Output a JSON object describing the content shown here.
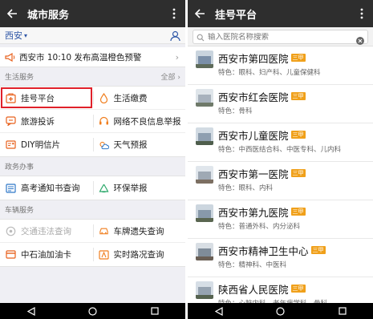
{
  "left": {
    "title": "城市服务",
    "city": "西安",
    "alert": "西安市 10:10 发布高温橙色预警",
    "sections": [
      {
        "name": "生活服务",
        "all_label": "全部",
        "rows": [
          [
            {
              "label": "挂号平台",
              "icon": "hospital-icon"
            },
            {
              "label": "生活缴费",
              "icon": "water-drop-icon"
            }
          ],
          [
            {
              "label": "旅游投诉",
              "icon": "chat-icon"
            },
            {
              "label": "网络不良信息举报",
              "icon": "headset-icon"
            }
          ],
          [
            {
              "label": "DIY明信片",
              "icon": "postcard-icon"
            },
            {
              "label": "天气预报",
              "icon": "weather-icon"
            }
          ]
        ]
      },
      {
        "name": "政务办事",
        "rows": [
          [
            {
              "label": "高考通知书查询",
              "icon": "notice-icon"
            },
            {
              "label": "环保举报",
              "icon": "recycle-icon"
            }
          ]
        ]
      },
      {
        "name": "车辆服务",
        "rows": [
          [
            {
              "label": "交通违法查询",
              "icon": "traffic-icon"
            },
            {
              "label": "车牌遗失查询",
              "icon": "license-plate-icon"
            }
          ],
          [
            {
              "label": "中石油加油卡",
              "icon": "fuel-card-icon"
            },
            {
              "label": "实时路况查询",
              "icon": "road-icon"
            }
          ]
        ]
      }
    ]
  },
  "right": {
    "title": "挂号平台",
    "search_placeholder": "输入医院名称搜索",
    "hospitals": [
      {
        "name": "西安市第四医院",
        "badge": "三甲",
        "spec": "特色：眼科、妇产科、儿童保健科"
      },
      {
        "name": "西安市红会医院",
        "badge": "三甲",
        "spec": "特色：骨科"
      },
      {
        "name": "西安市儿童医院",
        "badge": "三甲",
        "spec": "特色：中西医结合科、中医专科、儿内科"
      },
      {
        "name": "西安市第一医院",
        "badge": "三甲",
        "spec": "特色：眼科、内科"
      },
      {
        "name": "西安市第九医院",
        "badge": "三甲",
        "spec": "特色：普通外科、内分泌科"
      },
      {
        "name": "西安市精神卫生中心",
        "badge": "三甲",
        "spec": "特色：精神科、中医科"
      },
      {
        "name": "陕西省人民医院",
        "badge": "三甲",
        "spec": "特色：心脏内科、老年病学科、骨科"
      }
    ]
  },
  "colors": {
    "appbar": "#2e2e2e",
    "accent_red": "#e0202a",
    "accent_orange": "#f0a01a",
    "icon_blue": "#2e77c8",
    "icon_orange": "#f07e1e",
    "link_blue": "#2e56a6"
  }
}
